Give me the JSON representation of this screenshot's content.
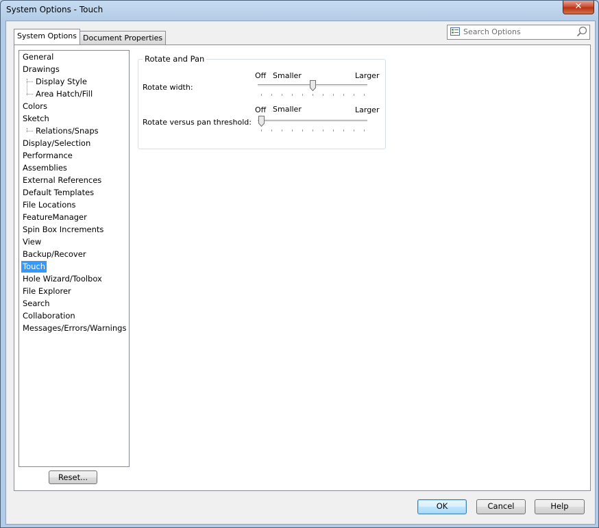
{
  "window": {
    "title": "System Options - Touch",
    "close_glyph": "✕"
  },
  "tabs": [
    {
      "label": "System Options",
      "active": true
    },
    {
      "label": "Document Properties",
      "active": false
    }
  ],
  "search": {
    "placeholder": "Search Options"
  },
  "tree": {
    "items": [
      {
        "label": "General",
        "level": 0
      },
      {
        "label": "Drawings",
        "level": 0
      },
      {
        "label": "Display Style",
        "level": 1
      },
      {
        "label": "Area Hatch/Fill",
        "level": 1
      },
      {
        "label": "Colors",
        "level": 0
      },
      {
        "label": "Sketch",
        "level": 0
      },
      {
        "label": "Relations/Snaps",
        "level": 1
      },
      {
        "label": "Display/Selection",
        "level": 0
      },
      {
        "label": "Performance",
        "level": 0
      },
      {
        "label": "Assemblies",
        "level": 0
      },
      {
        "label": "External References",
        "level": 0
      },
      {
        "label": "Default Templates",
        "level": 0
      },
      {
        "label": "File Locations",
        "level": 0
      },
      {
        "label": "FeatureManager",
        "level": 0
      },
      {
        "label": "Spin Box Increments",
        "level": 0
      },
      {
        "label": "View",
        "level": 0
      },
      {
        "label": "Backup/Recover",
        "level": 0
      },
      {
        "label": "Touch",
        "level": 0,
        "selected": true
      },
      {
        "label": "Hole Wizard/Toolbox",
        "level": 0
      },
      {
        "label": "File Explorer",
        "level": 0
      },
      {
        "label": "Search",
        "level": 0
      },
      {
        "label": "Collaboration",
        "level": 0
      },
      {
        "label": "Messages/Errors/Warnings",
        "level": 0
      }
    ]
  },
  "reset_label": "Reset...",
  "group": {
    "title": "Rotate and Pan",
    "sliders": [
      {
        "label": "Rotate width:",
        "off": "Off",
        "smaller": "Smaller",
        "larger": "Larger",
        "position": 0.5,
        "ticks": 11
      },
      {
        "label": "Rotate versus pan threshold:",
        "off": "Off",
        "smaller": "Smaller",
        "larger": "Larger",
        "position": 0.0,
        "ticks": 11
      }
    ]
  },
  "buttons": {
    "ok": "OK",
    "cancel": "Cancel",
    "help": "Help"
  },
  "colors": {
    "selection": "#3399ff",
    "titlebar": "#b9d1ea"
  }
}
